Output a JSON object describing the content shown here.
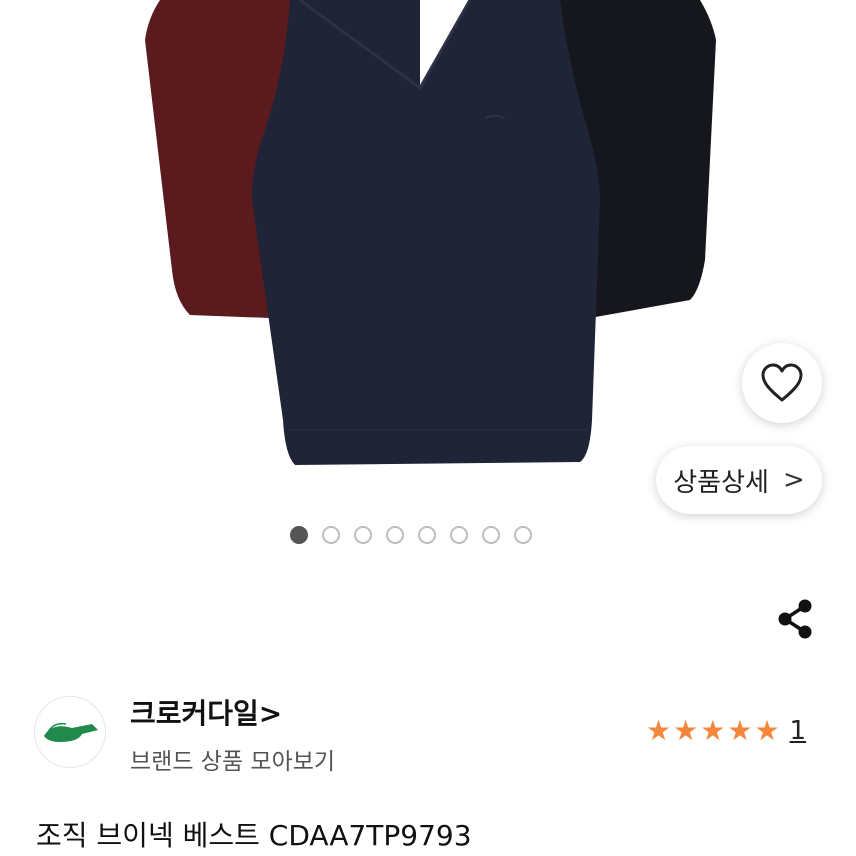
{
  "product": {
    "title": "조직 브이넥 베스트 CDAA7TP9793",
    "image_count": 8,
    "active_image": 1
  },
  "buttons": {
    "detail_label": "상품상세",
    "detail_chevron": ">"
  },
  "brand": {
    "name": "크로커다일>",
    "sub_link": "브랜드 상품 모아보기",
    "logo_color": "#1f8a4c"
  },
  "rating": {
    "stars": 5,
    "star_symbol": "★",
    "review_count": "1",
    "star_color": "#f5873c"
  },
  "icons": {
    "wish": "heart-outline-icon",
    "share": "share-icon"
  },
  "colors": {
    "vest_burgundy": "#5e1a1e",
    "vest_navy": "#1f2436",
    "vest_black": "#15161b"
  }
}
